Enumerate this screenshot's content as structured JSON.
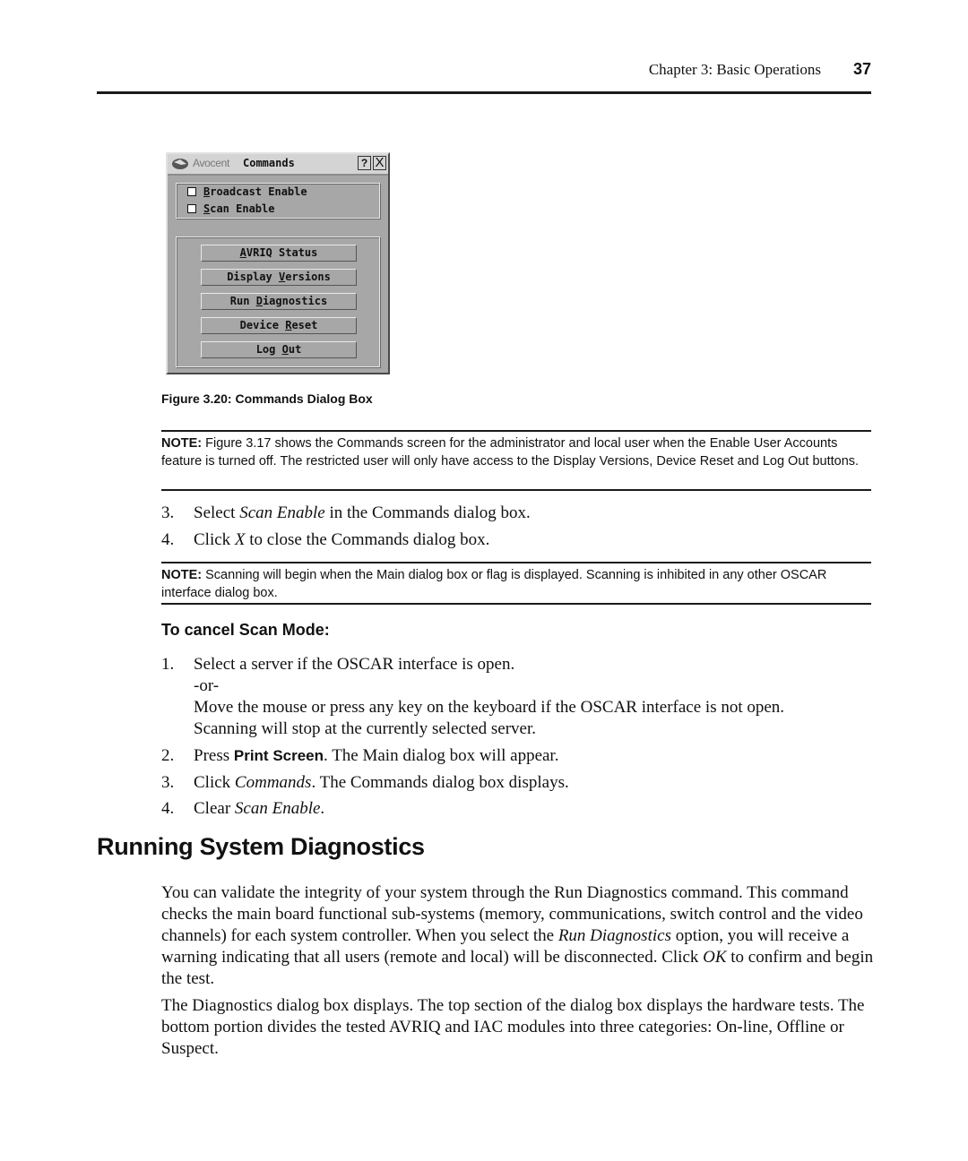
{
  "header": {
    "chapter": "Chapter 3: Basic Operations",
    "page_number": "37"
  },
  "dialog": {
    "brand": "Avocent",
    "title": "Commands",
    "help_label": "?",
    "close_label": "X",
    "logo_icon": "avocent-logo-icon",
    "checkboxes": [
      {
        "mnemonic": "B",
        "rest": "roadcast Enable",
        "checked": false
      },
      {
        "mnemonic": "S",
        "rest": "can Enable",
        "checked": false
      }
    ],
    "buttons": [
      {
        "pre": "",
        "mnemonic": "A",
        "post": "VRIQ Status"
      },
      {
        "pre": "Display ",
        "mnemonic": "V",
        "post": "ersions"
      },
      {
        "pre": "Run ",
        "mnemonic": "D",
        "post": "iagnostics"
      },
      {
        "pre": "Device ",
        "mnemonic": "R",
        "post": "eset"
      },
      {
        "pre": "Log ",
        "mnemonic": "O",
        "post": "ut"
      }
    ]
  },
  "figure_caption": "Figure 3.20: Commands Dialog Box",
  "note1": {
    "label": "NOTE:",
    "text": " Figure 3.17 shows the Commands screen for the administrator and local user when the Enable User Accounts feature is turned off. The restricted user will only have access to the Display Versions, Device Reset and Log Out buttons."
  },
  "steps_a": [
    {
      "num": "3.",
      "pre": "Select ",
      "em": "Scan Enable",
      "post": " in the Commands dialog box."
    },
    {
      "num": "4.",
      "pre": "Click ",
      "em": "X",
      "post": " to close the Commands dialog box."
    }
  ],
  "note2": {
    "label": "NOTE:",
    "text": " Scanning will begin when the Main dialog box or flag is displayed. Scanning is inhibited in any other OSCAR interface dialog box."
  },
  "subheading": "To cancel Scan Mode:",
  "steps_b": {
    "s1": {
      "num": "1.",
      "text": "Select a server if the OSCAR interface is open."
    },
    "s1_or": "-or-",
    "s1_cont1": "Move the mouse or press any key on the keyboard if the OSCAR interface is not open.",
    "s1_cont2": "Scanning will stop at the currently selected server.",
    "s2": {
      "num": "2.",
      "pre": "Press ",
      "bold": "Print Screen",
      "post": ". The Main dialog box will appear."
    },
    "s3": {
      "num": "3.",
      "pre": "Click ",
      "em": "Commands",
      "post": ". The Commands dialog box displays."
    },
    "s4": {
      "num": "4.",
      "pre": "Clear ",
      "em": "Scan Enable",
      "post": "."
    }
  },
  "section_heading": "Running System Diagnostics",
  "para1": {
    "pre": "You can validate the integrity of your system through the Run Diagnostics command. This command checks the main board functional sub-systems (memory, communications, switch control and the video channels) for each system controller. When you select the ",
    "em1": "Run Diagnostics",
    "mid": " option, you will receive a warning indicating that all users (remote and local) will be disconnected. Click ",
    "em2": "OK",
    "post": " to confirm and begin the test."
  },
  "para2": "The Diagnostics dialog box displays. The top section of the dialog box displays the hardware tests. The bottom portion divides the tested AVRIQ and IAC modules into three categories: On-line, Offline or Suspect."
}
